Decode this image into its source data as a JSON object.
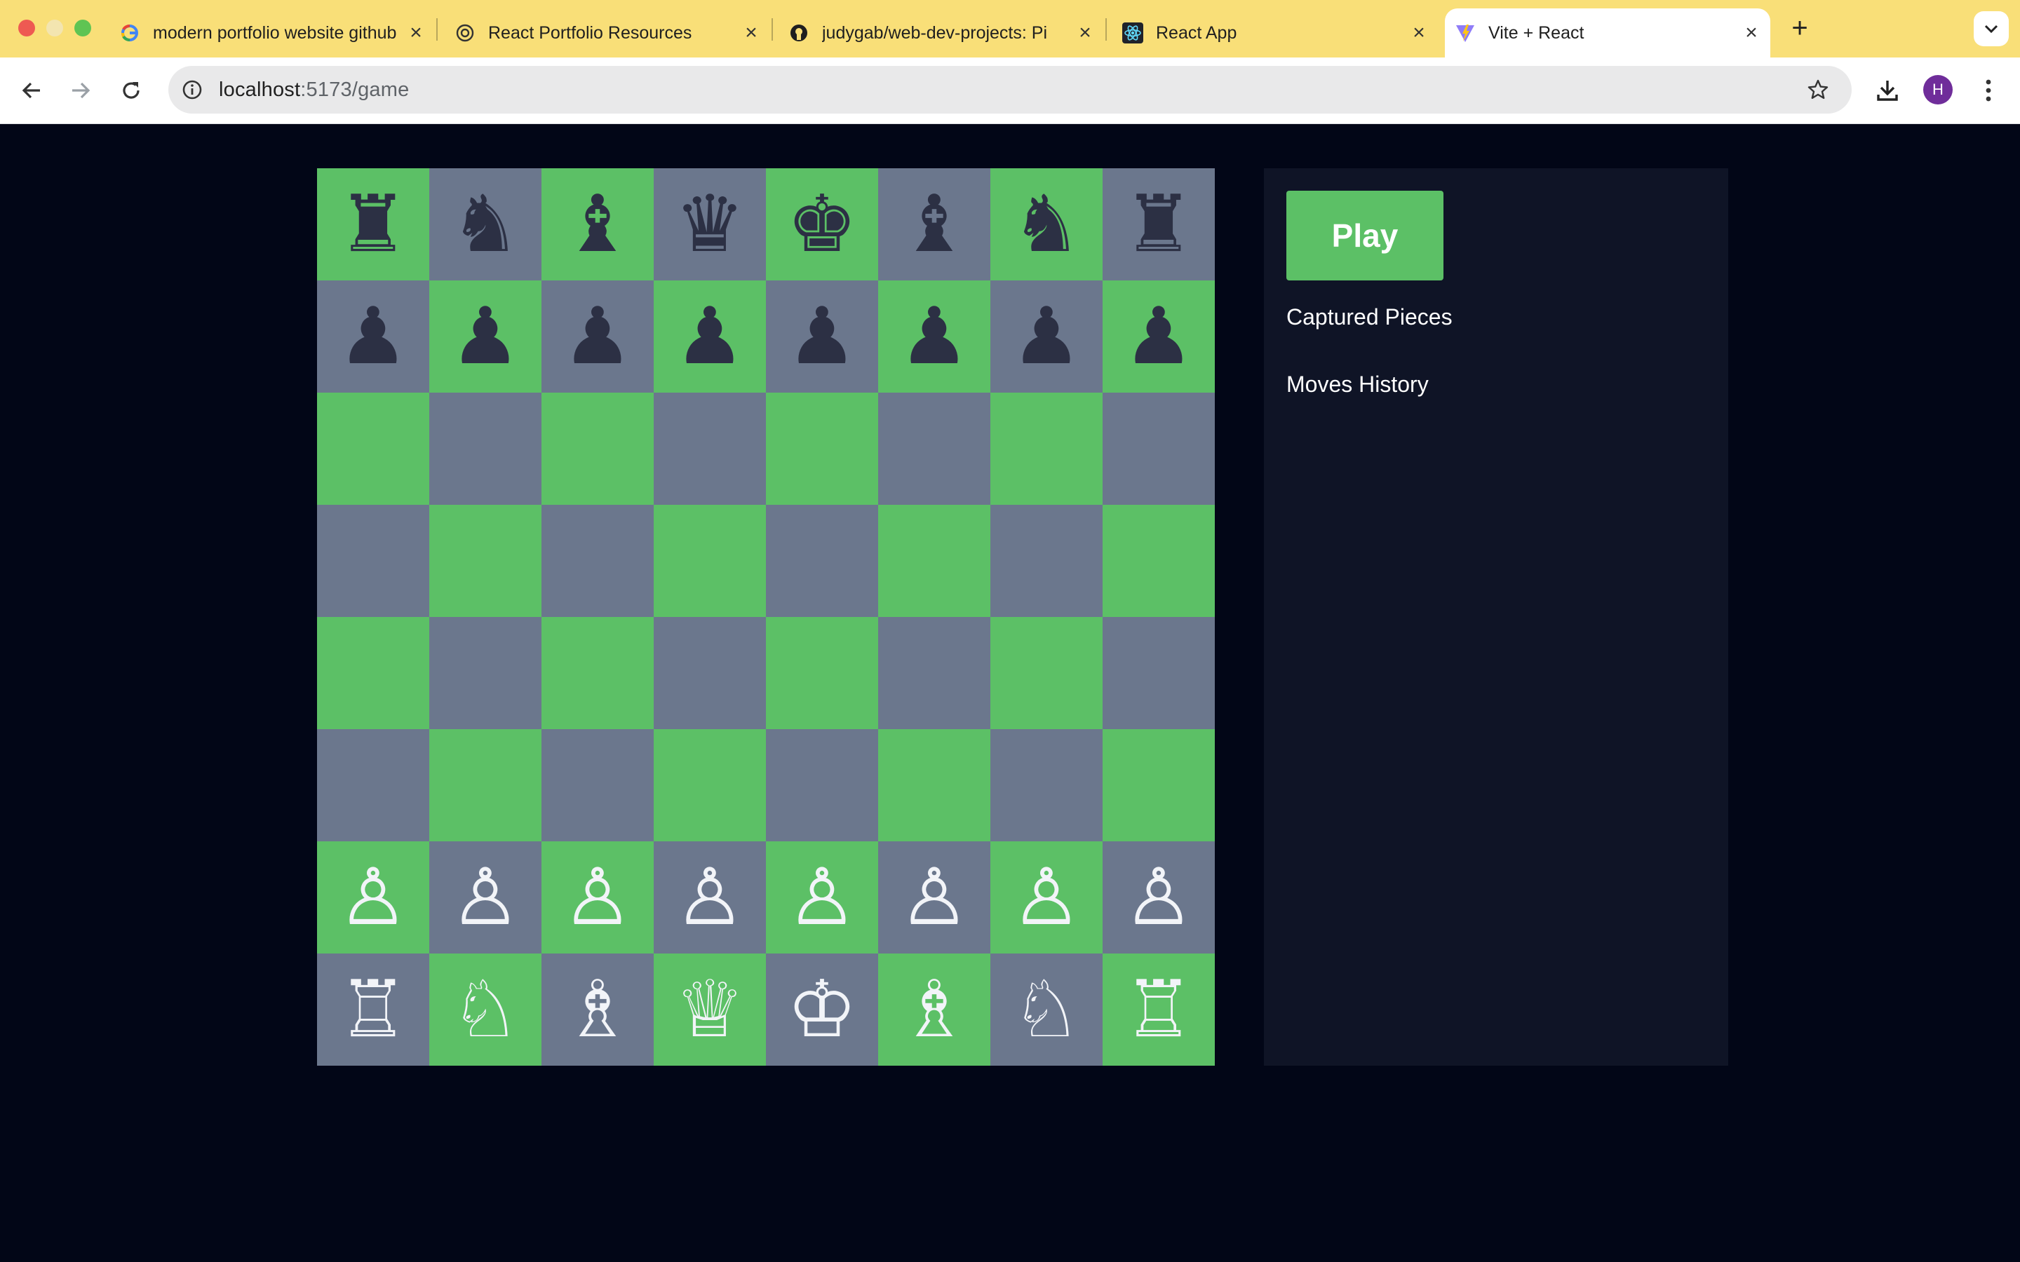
{
  "browser": {
    "tabs": [
      {
        "title": "modern portfolio website github",
        "favicon": "google-icon"
      },
      {
        "title": "React Portfolio Resources",
        "favicon": "openai-icon"
      },
      {
        "title": "judygab/web-dev-projects: Pi",
        "favicon": "github-icon"
      },
      {
        "title": "React App",
        "favicon": "react-icon"
      },
      {
        "title": "Vite + React",
        "favicon": "vite-icon",
        "active": true
      }
    ],
    "url_host": "localhost",
    "url_path": ":5173/game",
    "profile_initial": "H",
    "accent": "#f9df78"
  },
  "board": {
    "light_color": "#5cc066",
    "dark_color": "#6b778d",
    "black_piece_color": "#2c3044",
    "white_piece_color": "#f2f4f8",
    "ranks": [
      [
        "♜",
        "♞",
        "♝",
        "♛",
        "♚",
        "♝",
        "♞",
        "♜"
      ],
      [
        "♟",
        "♟",
        "♟",
        "♟",
        "♟",
        "♟",
        "♟",
        "♟"
      ],
      [
        "",
        "",
        "",
        "",
        "",
        "",
        "",
        ""
      ],
      [
        "",
        "",
        "",
        "",
        "",
        "",
        "",
        ""
      ],
      [
        "",
        "",
        "",
        "",
        "",
        "",
        "",
        ""
      ],
      [
        "",
        "",
        "",
        "",
        "",
        "",
        "",
        ""
      ],
      [
        "♙",
        "♙",
        "♙",
        "♙",
        "♙",
        "♙",
        "♙",
        "♙"
      ],
      [
        "♖",
        "♘",
        "♗",
        "♕",
        "♔",
        "♗",
        "♘",
        "♖"
      ]
    ]
  },
  "panel": {
    "play_label": "Play",
    "captured_heading": "Captured Pieces",
    "moves_heading": "Moves History"
  }
}
